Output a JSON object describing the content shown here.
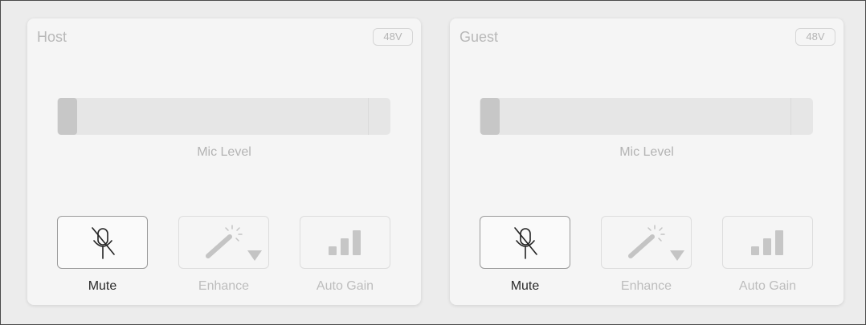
{
  "channels": [
    {
      "title": "Host",
      "badge": "48V",
      "slider_label": "Mic Level",
      "mic_level": 0,
      "buttons": {
        "mute": {
          "label": "Mute",
          "active": true,
          "icon": "mic-muted-icon"
        },
        "enhance": {
          "label": "Enhance",
          "active": false,
          "icon": "magic-wand-icon"
        },
        "autogain": {
          "label": "Auto Gain",
          "active": false,
          "icon": "signal-bars-icon"
        }
      }
    },
    {
      "title": "Guest",
      "badge": "48V",
      "slider_label": "Mic Level",
      "mic_level": 0,
      "buttons": {
        "mute": {
          "label": "Mute",
          "active": true,
          "icon": "mic-muted-icon"
        },
        "enhance": {
          "label": "Enhance",
          "active": false,
          "icon": "magic-wand-icon"
        },
        "autogain": {
          "label": "Auto Gain",
          "active": false,
          "icon": "signal-bars-icon"
        }
      }
    }
  ],
  "colors": {
    "background": "#ececec",
    "panel": "#f5f5f5",
    "active_border": "#9a9a9a",
    "disabled_text": "#bdbdbd",
    "active_text": "#2a2a2a"
  }
}
